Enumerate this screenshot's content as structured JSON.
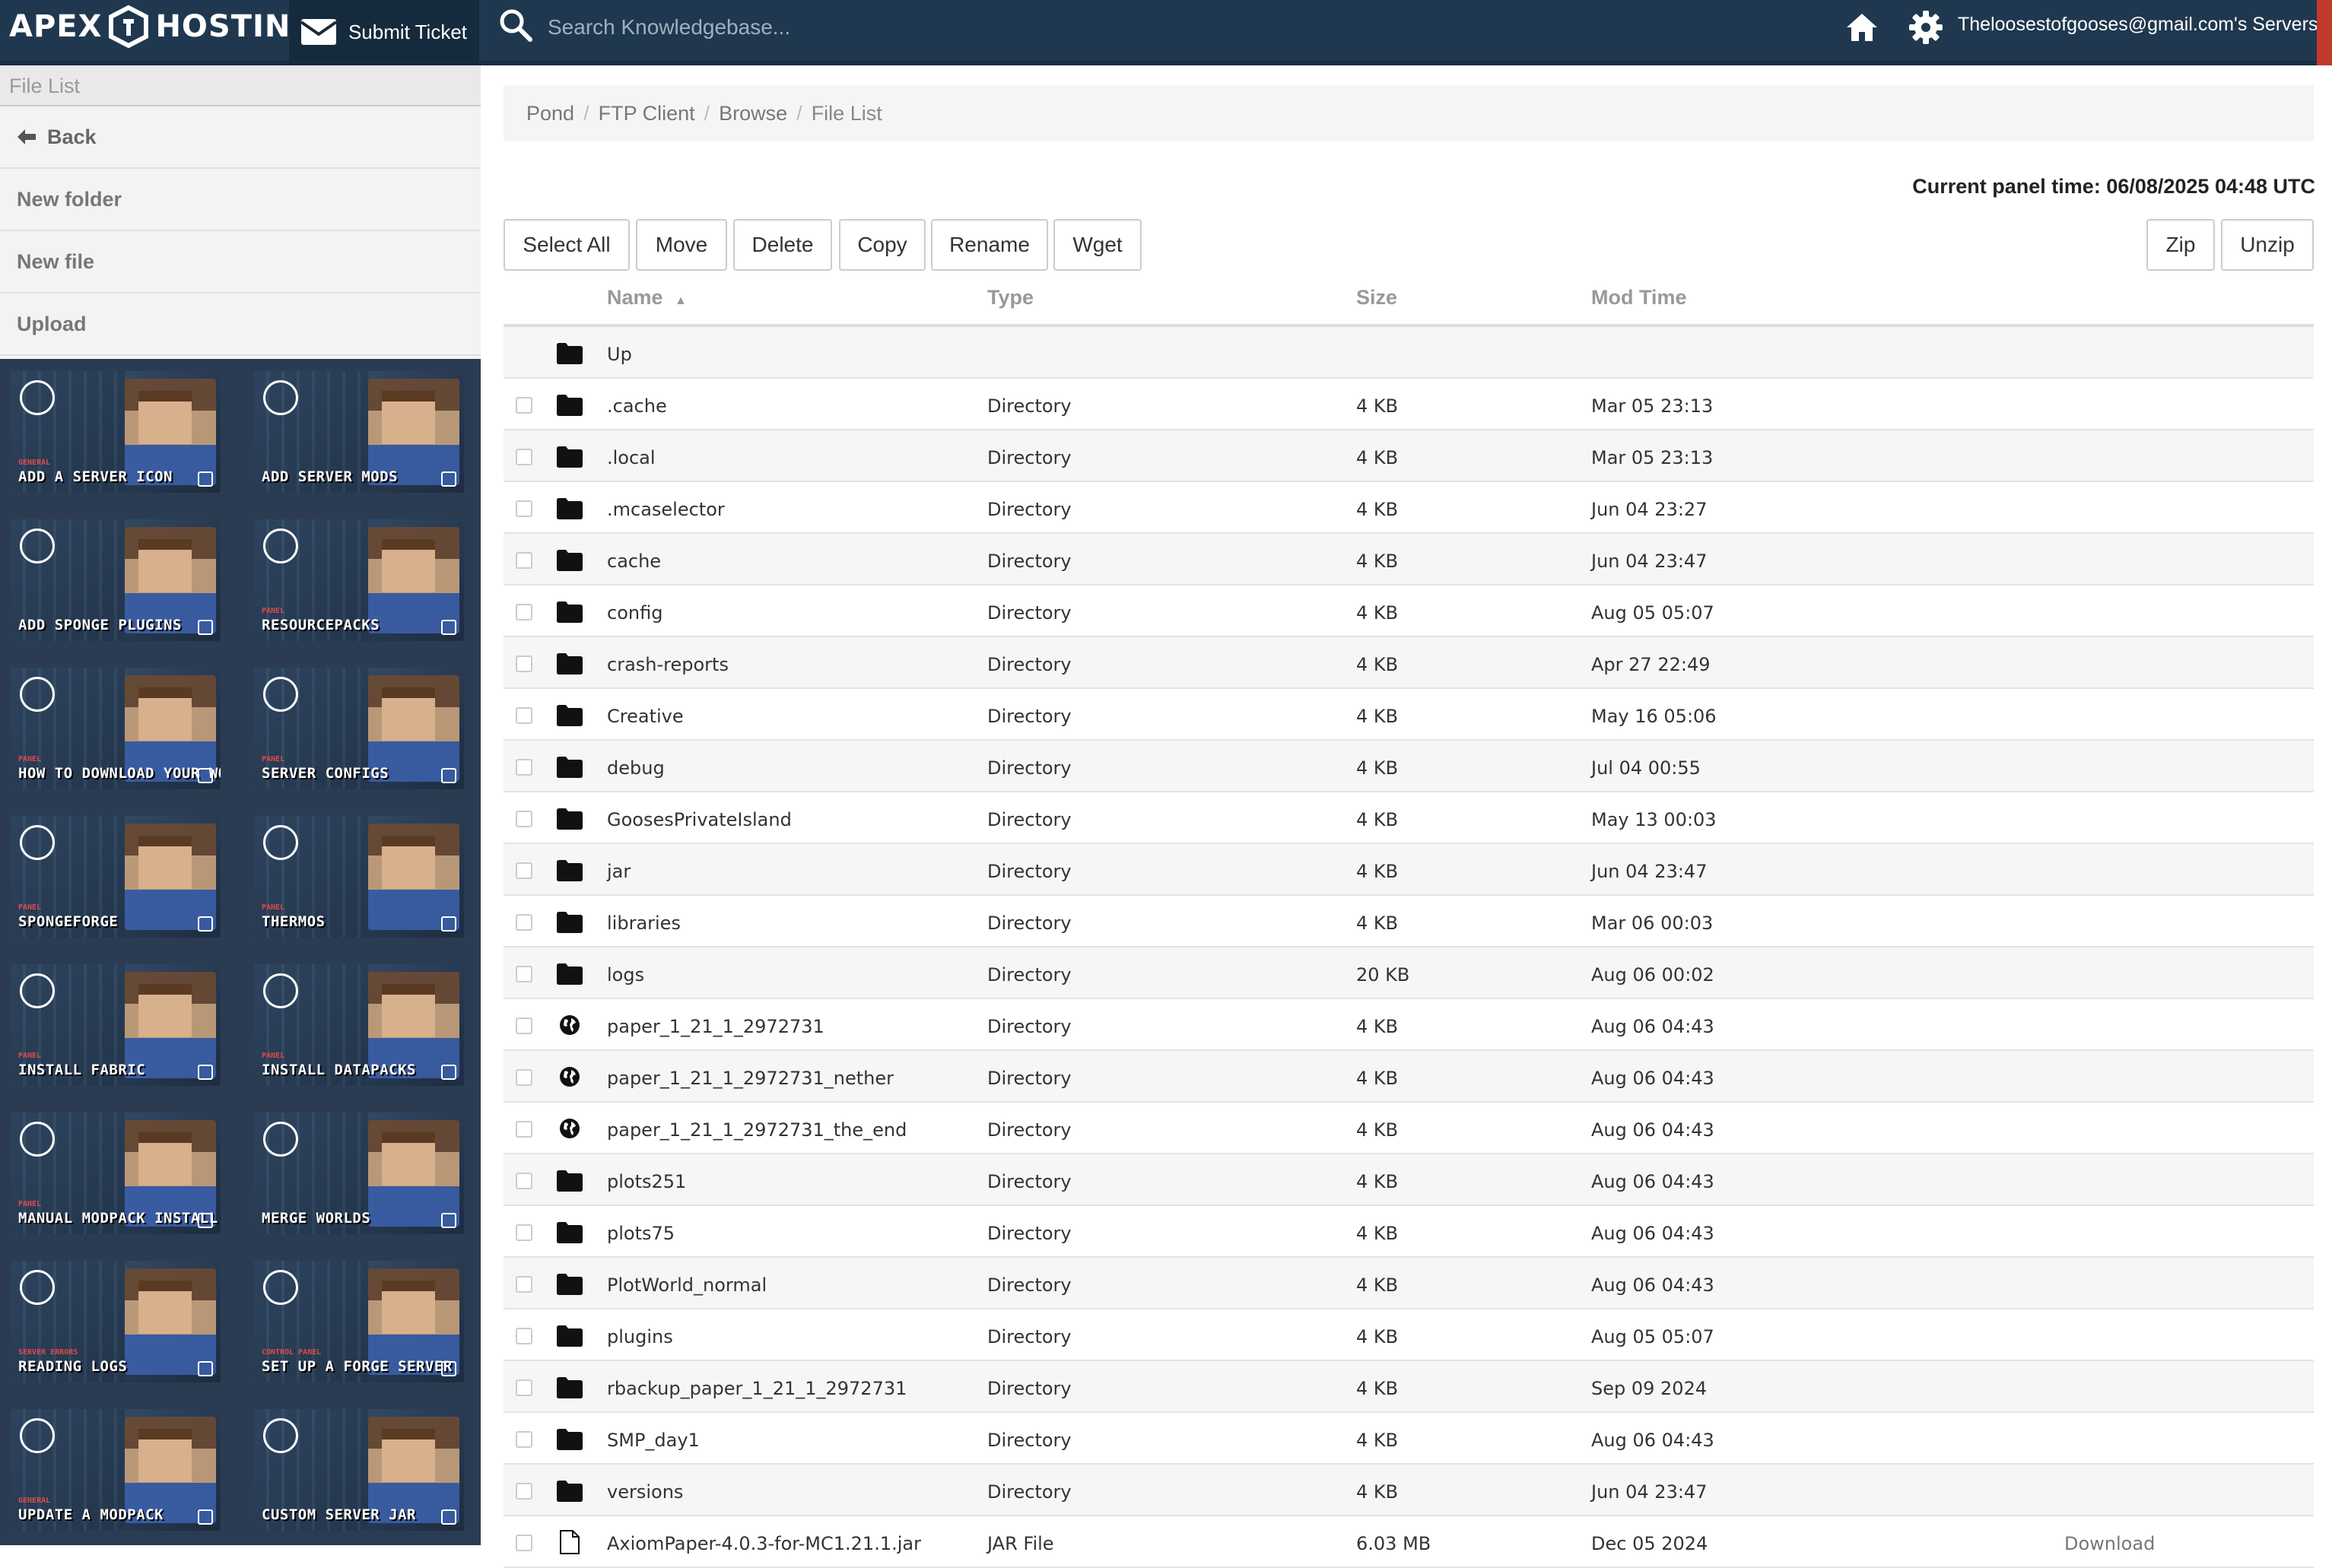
{
  "header": {
    "logo_left": "APEX",
    "logo_right": "HOSTING",
    "submit_ticket": "Submit Ticket",
    "search_placeholder": "Search Knowledgebase...",
    "servers_label": "Theloosestofgooses@gmail.com's Servers",
    "colors": {
      "bar": "#20384f",
      "ticket_bg": "#152a3d",
      "scroll_tab": "#c0392b"
    }
  },
  "sidebar": {
    "title": "File List",
    "items": [
      {
        "label": "Back",
        "icon": "arrow-left-icon"
      },
      {
        "label": "New folder"
      },
      {
        "label": "New file"
      },
      {
        "label": "Upload"
      }
    ],
    "tiles": [
      {
        "category": "GENERAL",
        "label": "ADD A SERVER ICON",
        "icon": "image-icon"
      },
      {
        "category": "",
        "label": "ADD SERVER MODS",
        "icon": "download-icon"
      },
      {
        "category": "",
        "label": "ADD SPONGE PLUGINS",
        "icon": "plugin-icon"
      },
      {
        "category": "PANEL",
        "label": "RESOURCEPACKS",
        "icon": "block-icon"
      },
      {
        "category": "PANEL",
        "label": "HOW TO DOWNLOAD YOUR WORLD",
        "icon": "download-icon"
      },
      {
        "category": "PANEL",
        "label": "SERVER CONFIGS",
        "icon": "file-icon"
      },
      {
        "category": "PANEL",
        "label": "SPONGEFORGE",
        "icon": "sponge-icon"
      },
      {
        "category": "PANEL",
        "label": "THERMOS",
        "icon": "thermos-icon"
      },
      {
        "category": "PANEL",
        "label": "INSTALL FABRIC",
        "icon": "fabric-icon"
      },
      {
        "category": "PANEL",
        "label": "INSTALL DATAPACKS",
        "icon": "star-folder-icon"
      },
      {
        "category": "PANEL",
        "label": "MANUAL MODPACK INSTALL",
        "icon": "clock-icon"
      },
      {
        "category": "",
        "label": "MERGE WORLDS",
        "icon": "merge-icon"
      },
      {
        "category": "SERVER ERRORS",
        "label": "READING LOGS",
        "icon": "book-icon"
      },
      {
        "category": "CONTROL PANEL",
        "label": "SET UP A FORGE SERVER",
        "icon": "anvil-icon"
      },
      {
        "category": "GENERAL",
        "label": "UPDATE A MODPACK",
        "icon": "cloud-download-icon"
      },
      {
        "category": "",
        "label": "CUSTOM SERVER JAR",
        "icon": "java-icon"
      }
    ]
  },
  "breadcrumb": [
    "Pond",
    "FTP Client",
    "Browse",
    "File List"
  ],
  "panel_time": "Current panel time: 06/08/2025 04:48 UTC",
  "toolbar": {
    "select_all": "Select All",
    "move": "Move",
    "delete": "Delete",
    "copy": "Copy",
    "rename": "Rename",
    "wget": "Wget",
    "zip": "Zip",
    "unzip": "Unzip"
  },
  "table": {
    "columns": {
      "name": "Name",
      "type": "Type",
      "size": "Size",
      "mod_time": "Mod Time"
    },
    "sort_indicator": "▲",
    "up_label": "Up",
    "rows": [
      {
        "name": ".cache",
        "type": "Directory",
        "size": "4 KB",
        "mod": "Mar 05 23:13",
        "icon": "folder-icon"
      },
      {
        "name": ".local",
        "type": "Directory",
        "size": "4 KB",
        "mod": "Mar 05 23:13",
        "icon": "folder-icon"
      },
      {
        "name": ".mcaselector",
        "type": "Directory",
        "size": "4 KB",
        "mod": "Jun 04 23:27",
        "icon": "folder-icon"
      },
      {
        "name": "cache",
        "type": "Directory",
        "size": "4 KB",
        "mod": "Jun 04 23:47",
        "icon": "folder-icon"
      },
      {
        "name": "config",
        "type": "Directory",
        "size": "4 KB",
        "mod": "Aug 05 05:07",
        "icon": "folder-icon"
      },
      {
        "name": "crash-reports",
        "type": "Directory",
        "size": "4 KB",
        "mod": "Apr 27 22:49",
        "icon": "folder-icon"
      },
      {
        "name": "Creative",
        "type": "Directory",
        "size": "4 KB",
        "mod": "May 16 05:06",
        "icon": "folder-icon"
      },
      {
        "name": "debug",
        "type": "Directory",
        "size": "4 KB",
        "mod": "Jul 04 00:55",
        "icon": "folder-icon"
      },
      {
        "name": "GoosesPrivateIsland",
        "type": "Directory",
        "size": "4 KB",
        "mod": "May 13 00:03",
        "icon": "folder-icon"
      },
      {
        "name": "jar",
        "type": "Directory",
        "size": "4 KB",
        "mod": "Jun 04 23:47",
        "icon": "folder-icon"
      },
      {
        "name": "libraries",
        "type": "Directory",
        "size": "4 KB",
        "mod": "Mar 06 00:03",
        "icon": "folder-icon"
      },
      {
        "name": "logs",
        "type": "Directory",
        "size": "20 KB",
        "mod": "Aug 06 00:02",
        "icon": "folder-icon"
      },
      {
        "name": "paper_1_21_1_2972731",
        "type": "Directory",
        "size": "4 KB",
        "mod": "Aug 06 04:43",
        "icon": "globe-icon"
      },
      {
        "name": "paper_1_21_1_2972731_nether",
        "type": "Directory",
        "size": "4 KB",
        "mod": "Aug 06 04:43",
        "icon": "globe-icon"
      },
      {
        "name": "paper_1_21_1_2972731_the_end",
        "type": "Directory",
        "size": "4 KB",
        "mod": "Aug 06 04:43",
        "icon": "globe-icon"
      },
      {
        "name": "plots251",
        "type": "Directory",
        "size": "4 KB",
        "mod": "Aug 06 04:43",
        "icon": "folder-icon"
      },
      {
        "name": "plots75",
        "type": "Directory",
        "size": "4 KB",
        "mod": "Aug 06 04:43",
        "icon": "folder-icon"
      },
      {
        "name": "PlotWorld_normal",
        "type": "Directory",
        "size": "4 KB",
        "mod": "Aug 06 04:43",
        "icon": "folder-icon"
      },
      {
        "name": "plugins",
        "type": "Directory",
        "size": "4 KB",
        "mod": "Aug 05 05:07",
        "icon": "folder-icon"
      },
      {
        "name": "rbackup_paper_1_21_1_2972731",
        "type": "Directory",
        "size": "4 KB",
        "mod": "Sep 09 2024",
        "icon": "folder-icon"
      },
      {
        "name": "SMP_day1",
        "type": "Directory",
        "size": "4 KB",
        "mod": "Aug 06 04:43",
        "icon": "folder-icon"
      },
      {
        "name": "versions",
        "type": "Directory",
        "size": "4 KB",
        "mod": "Jun 04 23:47",
        "icon": "folder-icon"
      },
      {
        "name": "AxiomPaper-4.0.3-for-MC1.21.1.jar",
        "type": "JAR File",
        "size": "6.03 MB",
        "mod": "Dec 05 2024",
        "icon": "file-icon",
        "download": "Download"
      }
    ]
  }
}
